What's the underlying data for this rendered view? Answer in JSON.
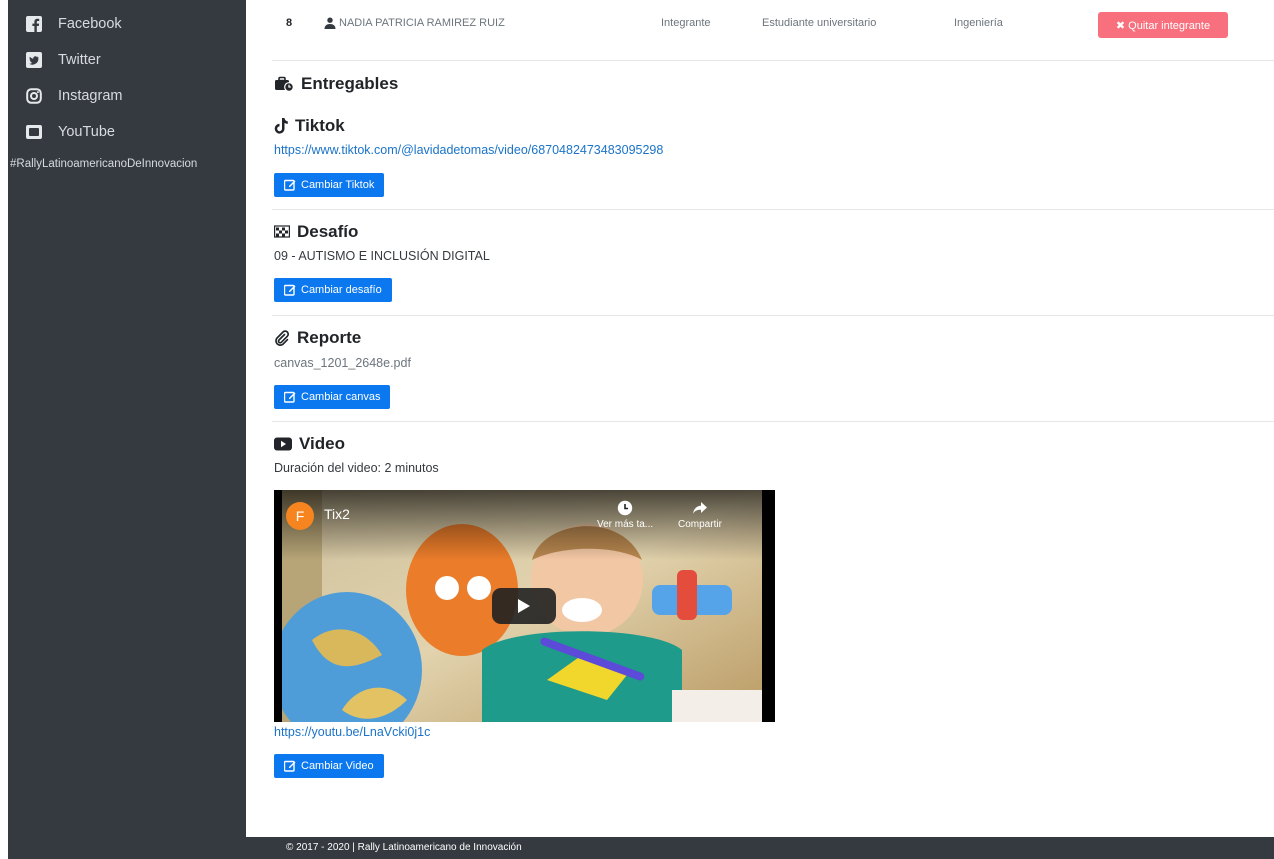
{
  "sidebar": {
    "items": [
      {
        "label": "Facebook",
        "icon": "facebook-icon"
      },
      {
        "label": "Twitter",
        "icon": "twitter-icon"
      },
      {
        "label": "Instagram",
        "icon": "instagram-icon"
      },
      {
        "label": "YouTube",
        "icon": "youtube-icon"
      }
    ],
    "hashtag": "#RallyLatinoamericanoDeInnovacion"
  },
  "member": {
    "number": "8",
    "name": "NADIA PATRICIA RAMIREZ RUIZ",
    "role": "Integrante",
    "type": "Estudiante universitario",
    "field": "Ingeniería",
    "remove_label": "✖ Quitar integrante"
  },
  "deliverables": {
    "title": "Entregables",
    "tiktok": {
      "title": "Tiktok",
      "url": "https://www.tiktok.com/@lavidadetomas/video/6870482473483095298",
      "button": "Cambiar Tiktok"
    },
    "challenge": {
      "title": "Desafío",
      "value": "09 - AUTISMO E INCLUSIÓN DIGITAL",
      "button": "Cambiar desafío"
    },
    "report": {
      "title": "Reporte",
      "file": "canvas_1201_2648e.pdf",
      "button": "Cambiar canvas"
    },
    "video": {
      "title": "Video",
      "duration": "Duración del video: 2 minutos",
      "player": {
        "channel_initial": "F",
        "title": "Tix2",
        "watch_later": "Ver más ta...",
        "share": "Compartir"
      },
      "url": "https://youtu.be/LnaVcki0j1c",
      "button": "Cambiar Video"
    }
  },
  "footer": {
    "text": "© 2017 - 2020 | Rally Latinoamericano de Innovación"
  },
  "colors": {
    "sidebar_bg": "#343a40",
    "primary": "#0b78f0",
    "danger": "#f86f7d",
    "link": "#1a73c8"
  }
}
